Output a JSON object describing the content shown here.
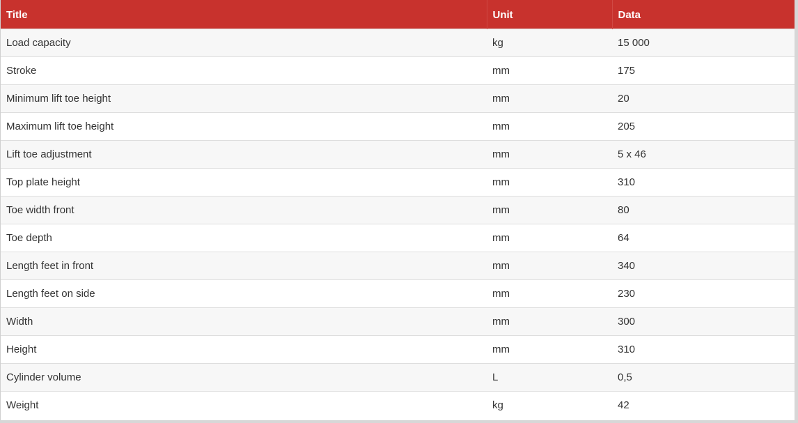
{
  "table": {
    "headers": {
      "title": "Title",
      "unit": "Unit",
      "data": "Data"
    },
    "rows": [
      {
        "title": "Load capacity",
        "unit": "kg",
        "data": "15 000"
      },
      {
        "title": "Stroke",
        "unit": "mm",
        "data": "175"
      },
      {
        "title": "Minimum lift toe height",
        "unit": "mm",
        "data": "20"
      },
      {
        "title": "Maximum lift toe height",
        "unit": "mm",
        "data": "205"
      },
      {
        "title": "Lift toe adjustment",
        "unit": "mm",
        "data": "5 x 46"
      },
      {
        "title": "Top plate height",
        "unit": "mm",
        "data": "310"
      },
      {
        "title": "Toe width front",
        "unit": "mm",
        "data": "80"
      },
      {
        "title": "Toe depth",
        "unit": "mm",
        "data": "64"
      },
      {
        "title": "Length feet in front",
        "unit": "mm",
        "data": "340"
      },
      {
        "title": "Length feet on side",
        "unit": "mm",
        "data": "230"
      },
      {
        "title": "Width",
        "unit": "mm",
        "data": "300"
      },
      {
        "title": "Height",
        "unit": "mm",
        "data": "310"
      },
      {
        "title": "Cylinder volume",
        "unit": "L",
        "data": "0,5"
      },
      {
        "title": "Weight",
        "unit": "kg",
        "data": "42"
      }
    ]
  },
  "colors": {
    "header_bg": "#c8322d",
    "header_text": "#ffffff",
    "row_odd": "#f7f7f7",
    "row_even": "#ffffff",
    "cell_text": "#333333"
  }
}
